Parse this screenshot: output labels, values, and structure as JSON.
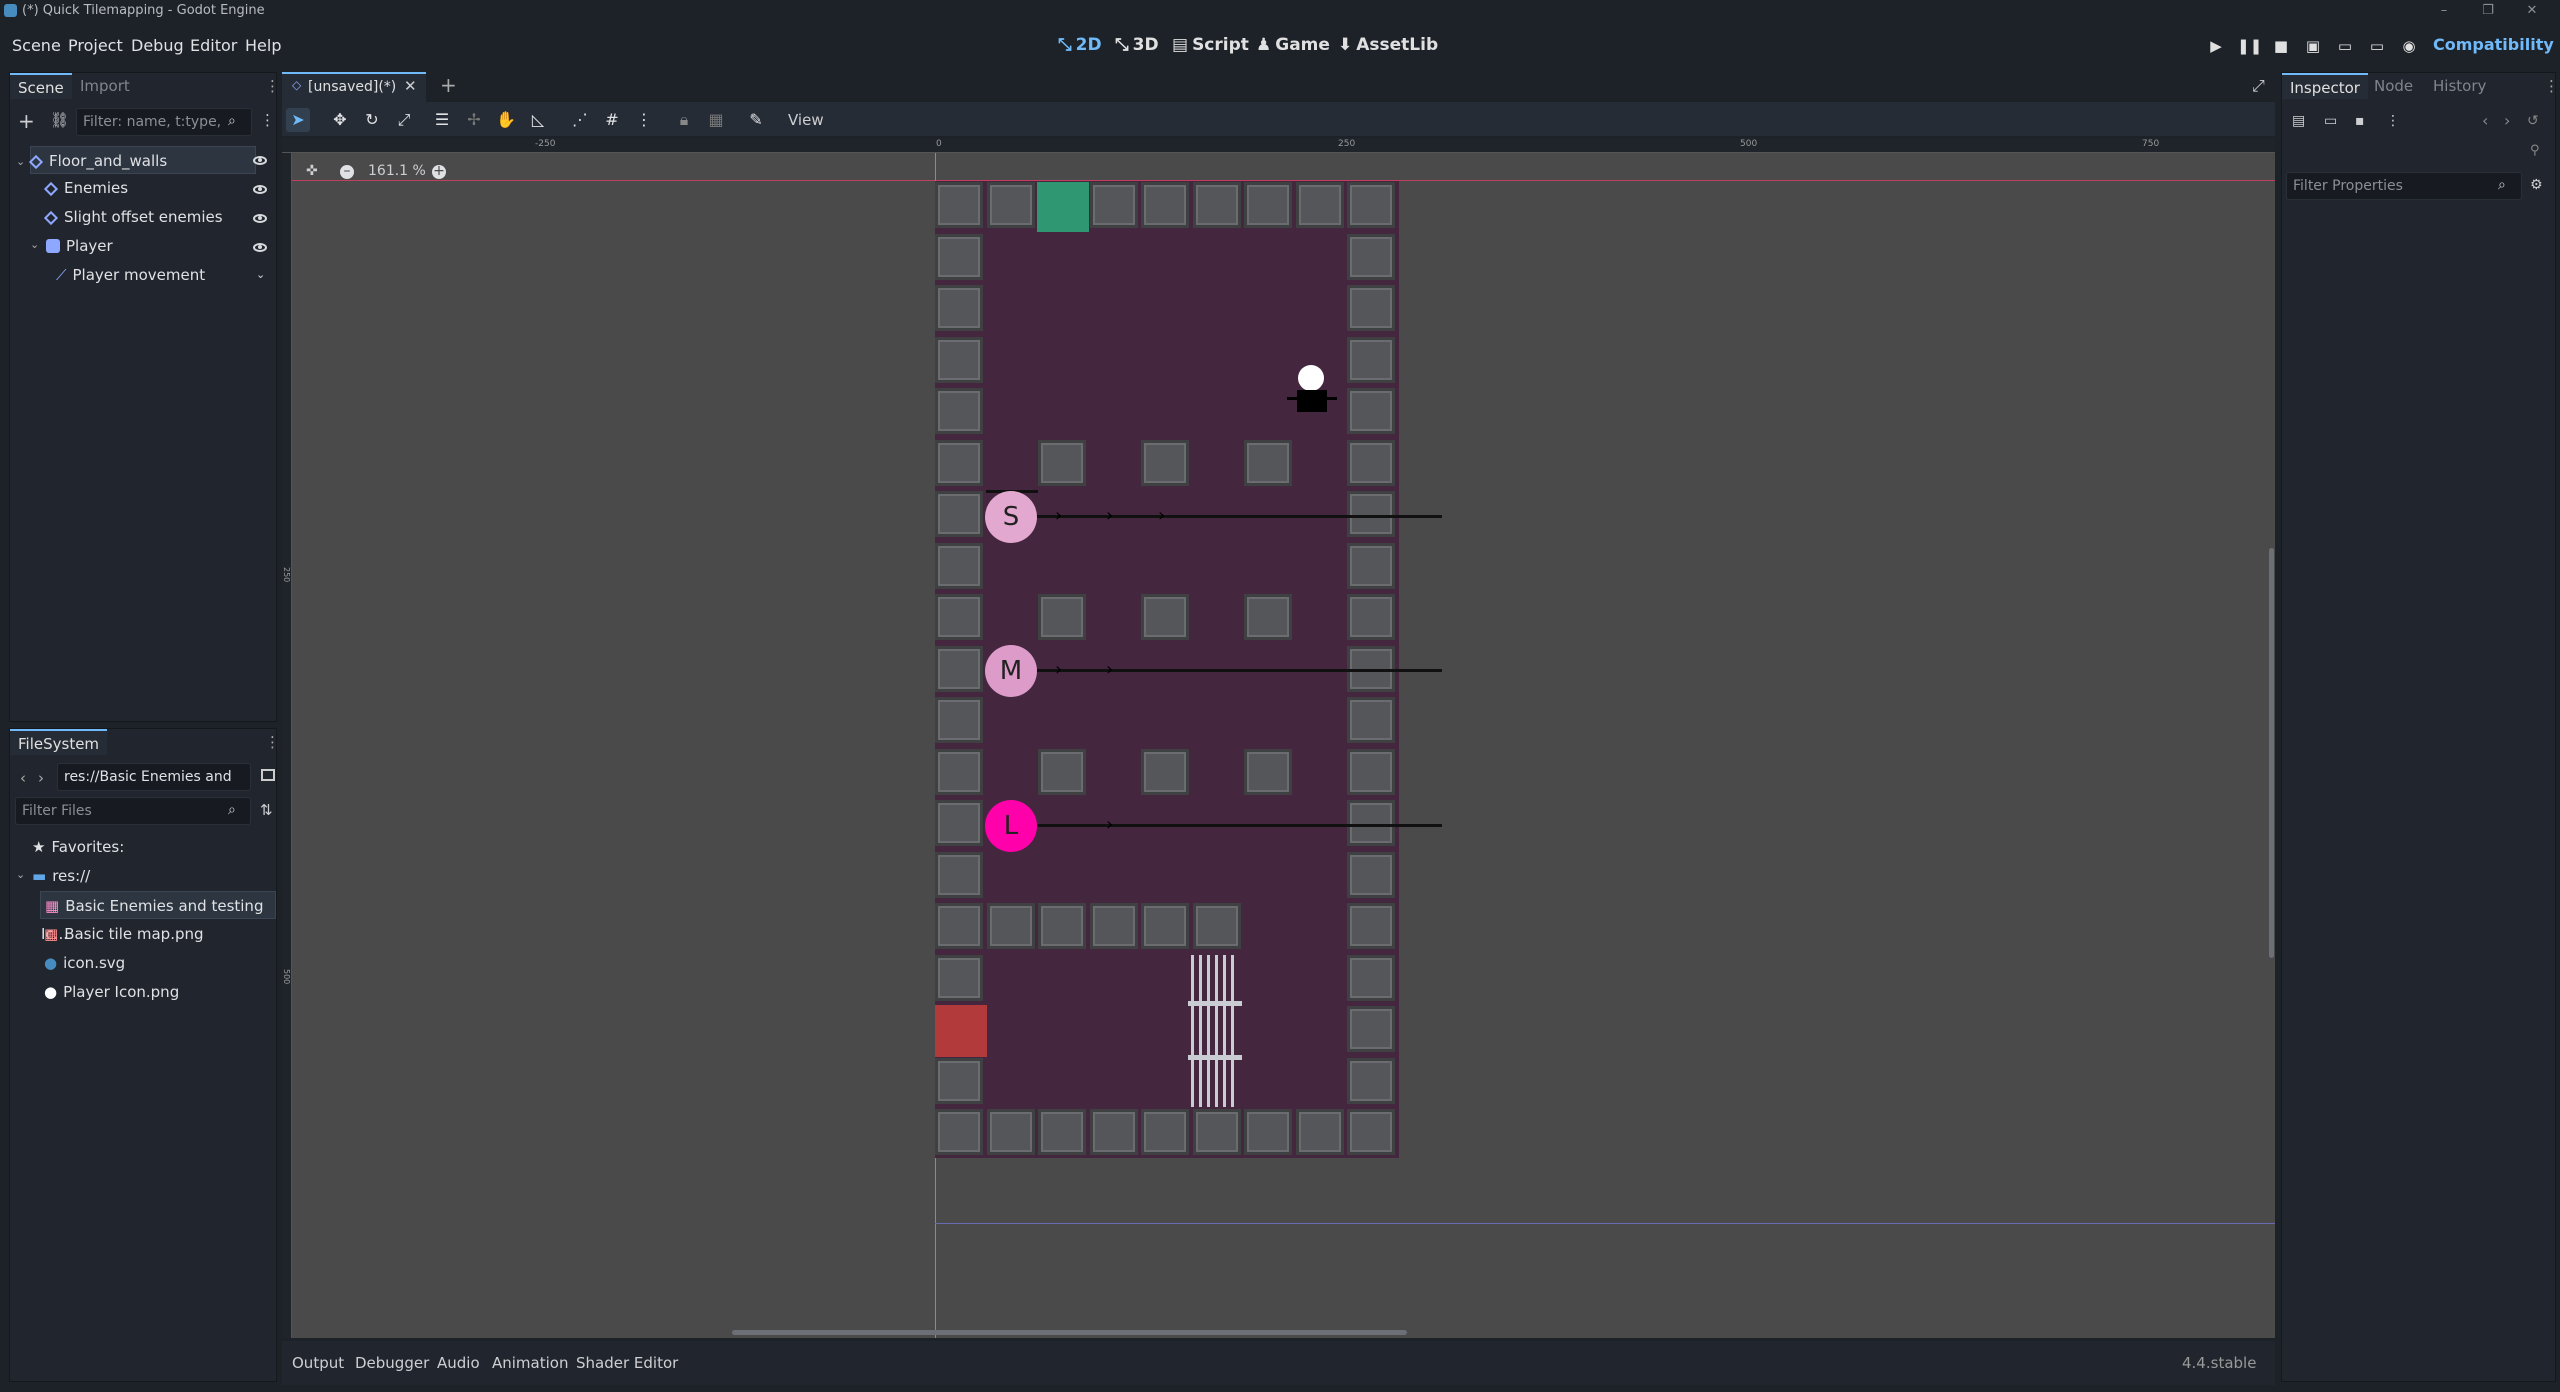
{
  "window": {
    "title": "(*) Quick Tilemapping - Godot Engine"
  },
  "menu": {
    "scene": "Scene",
    "project": "Project",
    "debug": "Debug",
    "editor": "Editor",
    "help": "Help"
  },
  "workspaces": {
    "w2d": "2D",
    "w3d": "3D",
    "script": "Script",
    "game": "Game",
    "assetlib": "AssetLib"
  },
  "renderer": "Compatibility",
  "scene_dock": {
    "tabs": [
      "Scene",
      "Import"
    ],
    "filter_placeholder": "Filter: name, t:type,",
    "nodes": [
      {
        "label": "Floor_and_walls"
      },
      {
        "label": "Enemies"
      },
      {
        "label": "Slight offset enemies"
      },
      {
        "label": "Player"
      },
      {
        "label": "Player movement"
      }
    ]
  },
  "filesystem": {
    "title": "FileSystem",
    "path": "res://Basic Enemies and te",
    "filter_placeholder": "Filter Files",
    "favorites": "Favorites:",
    "root": "res://",
    "files": [
      "Basic Enemies and testing Ic...",
      "Basic tile map.png",
      "icon.svg",
      "Player Icon.png"
    ]
  },
  "editor": {
    "tab": "[unsaved](*)",
    "view_menu": "View",
    "zoom": "161.1 %",
    "ruler_top": [
      "-250",
      "0",
      "250",
      "500",
      "750"
    ],
    "ruler_left": [
      "250",
      "500"
    ],
    "enemy_labels": [
      "S",
      "M",
      "L"
    ]
  },
  "bottom_tabs": [
    "Output",
    "Debugger",
    "Audio",
    "Animation",
    "Shader Editor"
  ],
  "version": "4.4.stable",
  "inspector": {
    "tabs": [
      "Inspector",
      "Node",
      "History"
    ],
    "filter_placeholder": "Filter Properties"
  },
  "colors": {
    "accent": "#70bafa",
    "room": "#44273e",
    "tile": "#555659",
    "goal": "#2f9772",
    "door": "#b33a3a",
    "enemy_s": "#e3a8cf",
    "enemy_m": "#dc9bc9",
    "enemy_l": "#ff00aa"
  }
}
